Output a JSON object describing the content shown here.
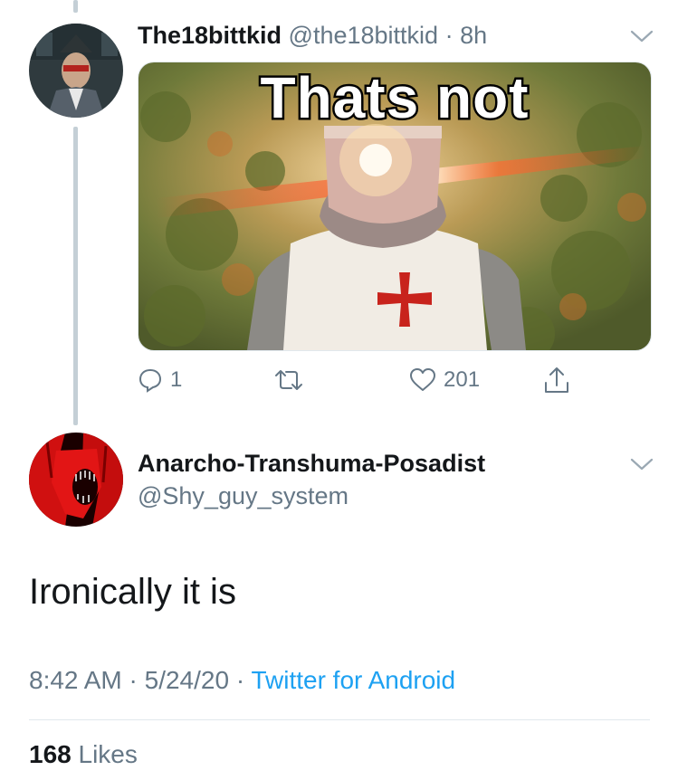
{
  "tweet": {
    "display_name": "The18bittkid",
    "handle": "@the18bittkid",
    "separator": "·",
    "time": "8h",
    "media_caption": "Thats not",
    "reply_count": "1",
    "like_count": "201"
  },
  "reply": {
    "display_name": "Anarcho-Transhuma-Posadist",
    "handle": "@Shy_guy_system",
    "text": "Ironically it is",
    "time": "8:42 AM",
    "separator": "·",
    "date": "5/24/20",
    "separator2": "·",
    "source": "Twitter for Android",
    "likes_count": "168",
    "likes_label": "Likes"
  },
  "colors": {
    "text_primary": "#14171a",
    "text_secondary": "#657786",
    "link": "#1da1f2",
    "thread_line": "#c4cfd6"
  },
  "icons": {
    "reply": "reply-icon",
    "retweet": "retweet-icon",
    "like": "heart-icon",
    "share": "share-icon",
    "more": "chevron-down-icon"
  }
}
